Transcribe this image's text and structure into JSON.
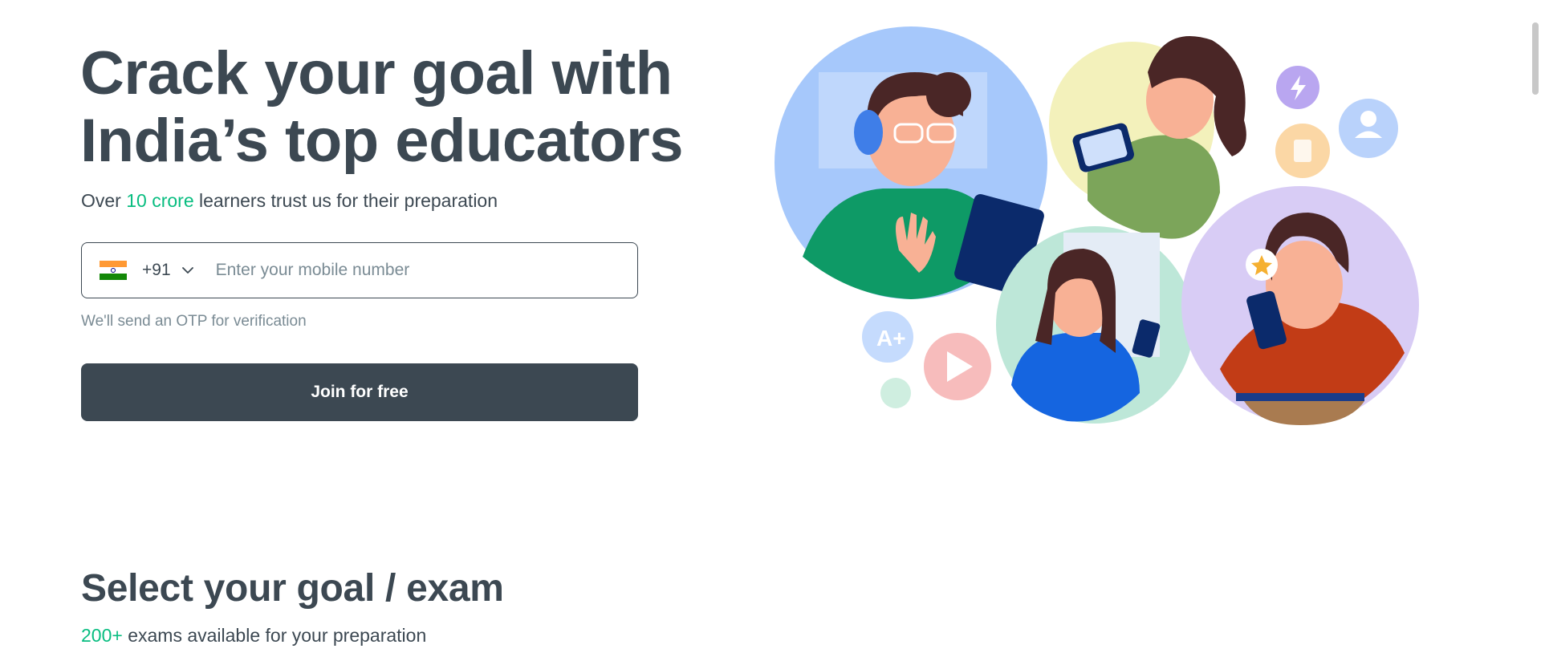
{
  "hero": {
    "title_line1": "Crack your goal with",
    "title_line2": "India’s top educators",
    "subtitle_pre": "Over ",
    "subtitle_accent": "10 crore",
    "subtitle_post": " learners trust us for their preparation"
  },
  "signup": {
    "country_code": "+91",
    "flag_icon": "india-flag-icon",
    "phone_placeholder": "Enter your mobile number",
    "otp_note": "We'll send an OTP for verification",
    "join_label": "Join for free"
  },
  "goal_section": {
    "title": "Select your goal / exam",
    "subtitle_accent": "200+",
    "subtitle_post": " exams available for your preparation"
  },
  "theme": {
    "text": "#3c4852",
    "accent": "#08bd80",
    "button_bg": "#3c4852"
  }
}
